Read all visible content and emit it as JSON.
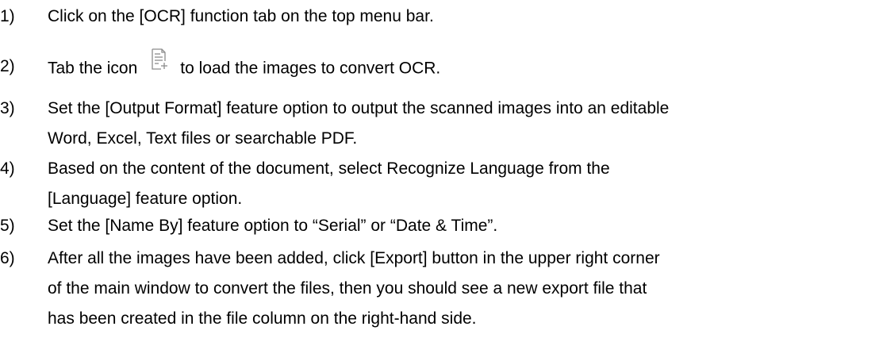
{
  "steps": [
    {
      "number": "1)",
      "lines": [
        "Click on the [OCR] function tab on the top menu bar."
      ]
    },
    {
      "number": "2)",
      "text_before": "Tab the icon",
      "icon": "add-document-icon",
      "text_after": "to load the images to convert OCR."
    },
    {
      "number": "3)",
      "lines": [
        "Set the [Output Format] feature option to output the scanned images into an editable",
        "Word, Excel, Text files or searchable PDF."
      ]
    },
    {
      "number": "4)",
      "lines": [
        "Based on the content of the document, select Recognize Language from the",
        "[Language] feature option."
      ]
    },
    {
      "number": "5)",
      "lines": [
        "Set the [Name By] feature option to “Serial” or “Date & Time”."
      ]
    },
    {
      "number": "6)",
      "lines": [
        "After all the images have been added, click [Export] button in the upper right corner",
        "of the main window to convert the files, then you should see a new export file that",
        "has been created in the file column on the right-hand side."
      ]
    }
  ],
  "colors": {
    "text": "#000000",
    "icon_stroke": "#8c8c8c"
  }
}
